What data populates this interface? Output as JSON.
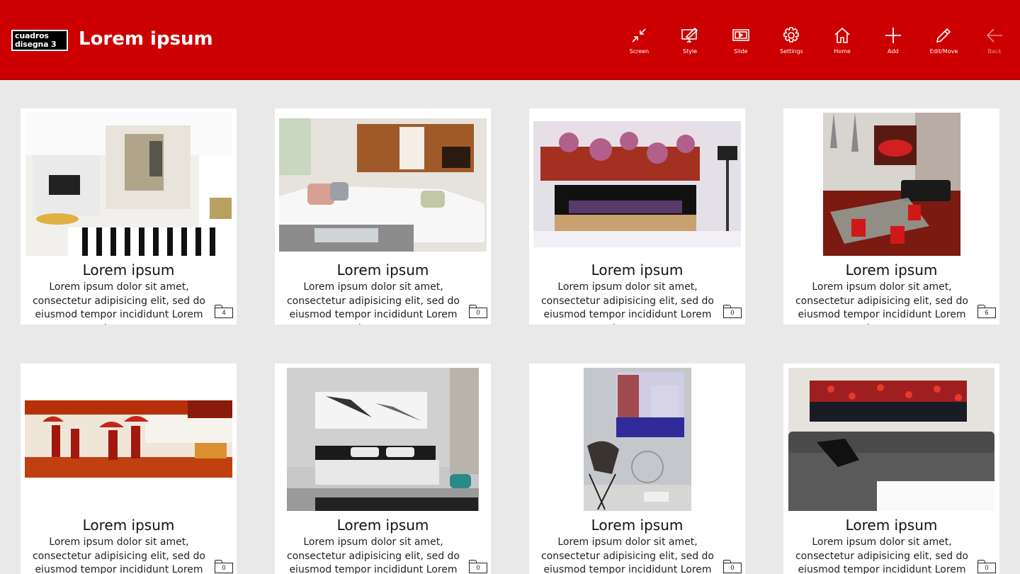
{
  "header": {
    "logo_line1": "cuadros",
    "logo_line2": "disegna 3",
    "title": "Lorem ipsum"
  },
  "toolbar": [
    {
      "label": "Screen",
      "icon": "collapse-arrows-icon",
      "enabled": true
    },
    {
      "label": "Style",
      "icon": "monitor-brush-icon",
      "enabled": true
    },
    {
      "label": "Slide",
      "icon": "slideshow-icon",
      "enabled": true
    },
    {
      "label": "Settings",
      "icon": "gear-icon",
      "enabled": true
    },
    {
      "label": "Home",
      "icon": "home-icon",
      "enabled": true
    },
    {
      "label": "Add",
      "icon": "plus-icon",
      "enabled": true
    },
    {
      "label": "Edit/Move",
      "icon": "pencil-icon",
      "enabled": true
    },
    {
      "label": "Back",
      "icon": "back-arrow-icon",
      "enabled": false
    }
  ],
  "cards": [
    {
      "title": "Lorem ipsum",
      "desc": "Lorem ipsum dolor sit amet, consectetur adipisicing elit, sed do eiusmod tempor incididunt Lorem ipsum",
      "count": "4",
      "image": "abstract-painting-living-room"
    },
    {
      "title": "Lorem ipsum",
      "desc": "Lorem ipsum dolor sit amet, consectetur adipisicing elit, sed do eiusmod tempor incididunt Lorem ipsum",
      "count": "0",
      "image": "panoramic-painting-white-sofa"
    },
    {
      "title": "Lorem ipsum",
      "desc": "Lorem ipsum dolor sit amet, consectetur adipisicing elit, sed do eiusmod tempor incididunt Lorem ipsum",
      "count": "0",
      "image": "orchid-painting-bedroom"
    },
    {
      "title": "Lorem ipsum",
      "desc": "Lorem ipsum dolor sit amet, consectetur adipisicing elit, sed do eiusmod tempor incididunt Lorem ipsum",
      "count": "6",
      "image": "red-car-painting-loft"
    },
    {
      "title": "Lorem ipsum",
      "desc": "Lorem ipsum dolor sit amet, consectetur adipisicing elit, sed do eiusmod tempor incididunt Lorem ipsum",
      "count": "0",
      "image": "umbrella-figures-painting"
    },
    {
      "title": "Lorem ipsum",
      "desc": "Lorem ipsum dolor sit amet, consectetur adipisicing elit, sed do eiusmod tempor incididunt Lorem ipsum",
      "count": "0",
      "image": "monochrome-painting-bedroom"
    },
    {
      "title": "Lorem ipsum",
      "desc": "Lorem ipsum dolor sit amet, consectetur adipisicing elit, sed do eiusmod tempor incididunt Lorem ipsum",
      "count": "0",
      "image": "city-street-painting-chair"
    },
    {
      "title": "Lorem ipsum",
      "desc": "Lorem ipsum dolor sit amet, consectetur adipisicing elit, sed do eiusmod tempor incididunt Lorem ipsum",
      "count": "0",
      "image": "red-flowers-painting-grey-sofa"
    }
  ]
}
